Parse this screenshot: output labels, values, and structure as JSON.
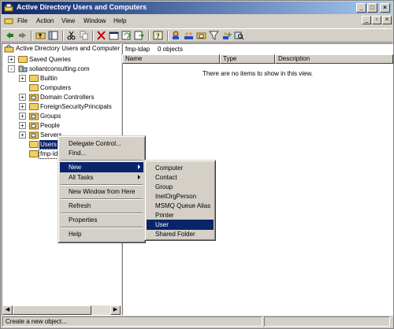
{
  "window": {
    "title": "Active Directory Users and Computers"
  },
  "menubar": {
    "items": [
      "File",
      "Action",
      "View",
      "Window",
      "Help"
    ]
  },
  "toolbar": {
    "icons": [
      "back-icon",
      "forward-icon",
      "up-folder-icon",
      "show-tree-icon",
      "cut-icon",
      "copy-icon",
      "delete-icon",
      "properties-icon",
      "refresh-icon",
      "export-icon",
      "help-icon",
      "new-user-icon",
      "new-group-icon",
      "new-ou-icon",
      "filter-icon",
      "add-to-group-icon",
      "find-icon"
    ]
  },
  "tree": {
    "root": "Active Directory Users and Computer",
    "items": [
      {
        "label": "Saved Queries",
        "expander": "+"
      },
      {
        "label": "soliantconsulting.com",
        "expander": "-"
      },
      {
        "label": "Builtin",
        "expander": "+"
      },
      {
        "label": "Computers",
        "expander": ""
      },
      {
        "label": "Domain Controllers",
        "expander": "+"
      },
      {
        "label": "ForeignSecurityPrincipals",
        "expander": "+"
      },
      {
        "label": "Groups",
        "expander": "+"
      },
      {
        "label": "People",
        "expander": "+"
      },
      {
        "label": "Servers",
        "expander": "+"
      },
      {
        "label": "Users",
        "expander": ""
      },
      {
        "label": "fmp-ldap",
        "expander": ""
      }
    ]
  },
  "right": {
    "title": "fmp-ldap",
    "count": "0 objects",
    "columns": [
      "Name",
      "Type",
      "Description"
    ],
    "empty_message": "There are no items to show in this view."
  },
  "context_menu": {
    "items": [
      {
        "label": "Delegate Control..."
      },
      {
        "label": "Find..."
      },
      {
        "label": "New",
        "submenu": true,
        "selected": true
      },
      {
        "label": "All Tasks",
        "submenu": true
      },
      {
        "label": "New Window from Here"
      },
      {
        "label": "Refresh"
      },
      {
        "label": "Properties"
      },
      {
        "label": "Help"
      }
    ]
  },
  "submenu": {
    "items": [
      "Computer",
      "Contact",
      "Group",
      "InetOrgPerson",
      "MSMQ Queue Alias",
      "Printer",
      "User",
      "Shared Folder"
    ],
    "selected": "User"
  },
  "statusbar": {
    "text": "Create a new object..."
  },
  "colors": {
    "title_start": "#0a246a",
    "title_end": "#a6caf0",
    "selection": "#0a246a",
    "face": "#d4d0c8"
  }
}
